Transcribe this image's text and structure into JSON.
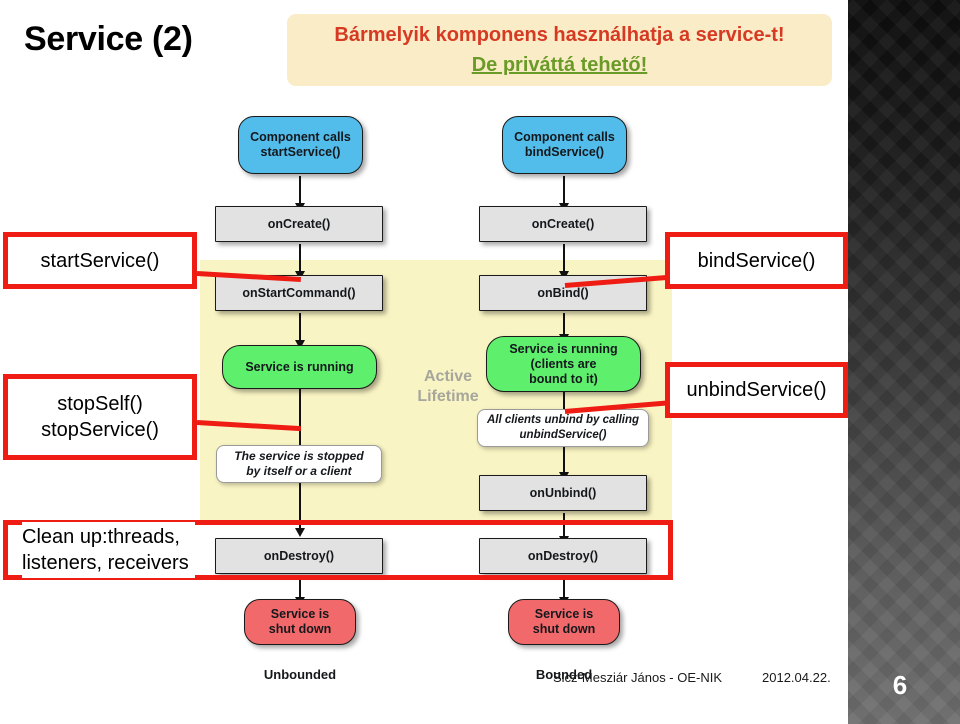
{
  "slide": {
    "title": "Service (2)",
    "callout": {
      "line1": "Bármelyik komponens használhatja a service-t!",
      "line2": "De priváttá tehető!"
    },
    "footer": {
      "author": "Sicz-Mesziár János - OE-NIK",
      "date": "2012.04.22.",
      "page_number": "6"
    },
    "colors": {
      "callout_bg": "#fbecc8",
      "callout_line1": "#d63a22",
      "callout_line2": "#6a9b28",
      "annotation_border": "#ee1c12",
      "active_band": "#f9f4c3",
      "node_blue": "#52bdeb",
      "node_gray": "#e2e2e2",
      "node_green": "#5ef06c",
      "node_red": "#f2696b"
    }
  },
  "diagram": {
    "active_lifetime_label": "Active\nLifetime",
    "active_lifetime_line1": "Active",
    "active_lifetime_line2": "Lifetime",
    "unbounded": {
      "column_label": "Unbounded",
      "nodes": [
        {
          "text1": "Component calls",
          "text2": "startService()"
        },
        {
          "text1": "onCreate()"
        },
        {
          "text1": "onStartCommand()"
        },
        {
          "text1": "Service is running"
        },
        {
          "text1": "The service is stopped",
          "text2": "by itself or a client"
        },
        {
          "text1": "onDestroy()"
        },
        {
          "text1": "Service is",
          "text2": "shut down"
        }
      ]
    },
    "bounded": {
      "column_label": "Bounded",
      "nodes": [
        {
          "text1": "Component calls",
          "text2": "bindService()"
        },
        {
          "text1": "onCreate()"
        },
        {
          "text1": "onBind()"
        },
        {
          "text1": "Service is running",
          "text2": "(clients are",
          "text3": "bound to it)"
        },
        {
          "text1": "All clients unbind by calling",
          "text2": "unbindService()"
        },
        {
          "text1": "onUnbind()"
        },
        {
          "text1": "onDestroy()"
        },
        {
          "text1": "Service is",
          "text2": "shut down"
        }
      ]
    }
  },
  "annotations": [
    {
      "id": "start-service",
      "text": "startService()"
    },
    {
      "id": "bind-service",
      "text": "bindService()"
    },
    {
      "id": "stop-self",
      "line1": "stopSelf()",
      "line2": "stopService()"
    },
    {
      "id": "unbind-service",
      "text": "unbindService()"
    },
    {
      "id": "clean-up",
      "line1": "Clean up:threads,",
      "line2": "listeners,  receivers"
    }
  ]
}
